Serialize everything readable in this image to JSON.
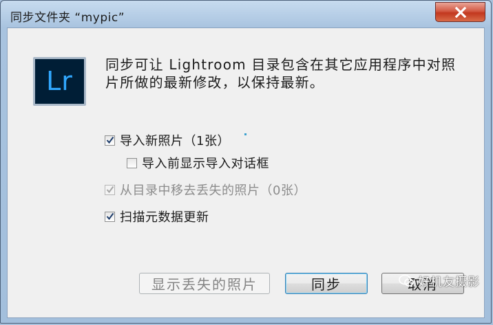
{
  "window": {
    "title": "同步文件夹 “mypic”"
  },
  "logo": {
    "text": "Lr",
    "bg": "#001e36",
    "fg": "#31a8ff"
  },
  "message": {
    "line1": "同步可让 Lightroom 目录包含在其它应用程序中对照",
    "line2": "片所做的最新修改，以保持最新。"
  },
  "options": {
    "import_new": {
      "label": "导入新照片（1张）",
      "checked": true,
      "enabled": true
    },
    "show_import_dialog": {
      "label": "导入前显示导入对话框",
      "checked": false,
      "enabled": true
    },
    "remove_missing": {
      "label": "从目录中移去丢失的照片（0张）",
      "checked": true,
      "enabled": false
    },
    "scan_metadata": {
      "label": "扫描元数据更新",
      "checked": true,
      "enabled": true
    }
  },
  "buttons": {
    "show_missing": "显示丢失的照片",
    "sync": "同步",
    "cancel": "取消"
  },
  "watermark": {
    "text": "好机友摄影",
    "icon": "chat-bubble-icon"
  }
}
